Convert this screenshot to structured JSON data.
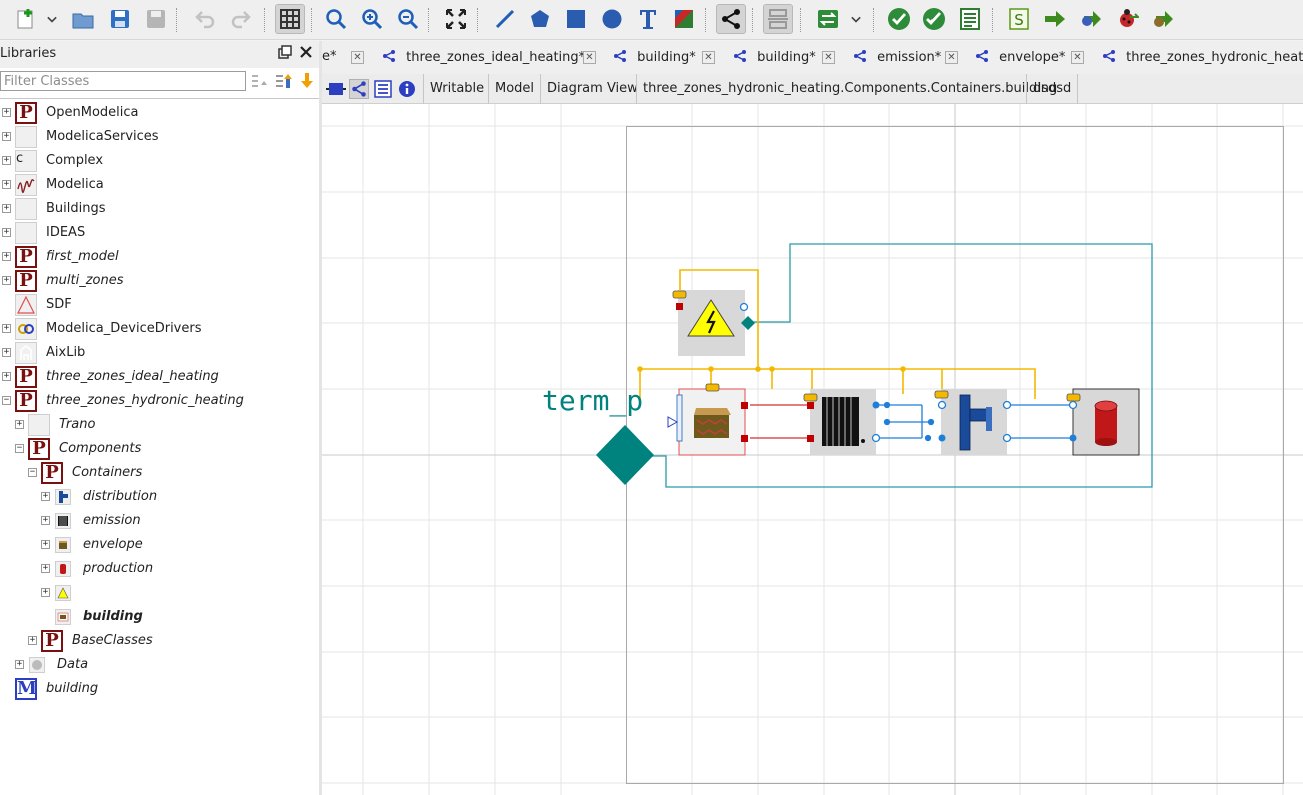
{
  "toolbar": {
    "buttons": [
      "new-icon",
      "dropdown-icon",
      "open-icon",
      "save-icon",
      "save-all-icon",
      "undo-icon",
      "redo-icon",
      "grid-icon",
      "zoom-reset-icon",
      "zoom-in-icon",
      "zoom-out-icon",
      "fit-icon",
      "line-icon",
      "polygon-icon",
      "rectangle-icon",
      "ellipse-icon",
      "text-icon",
      "bitmap-icon",
      "connect-icon",
      "transition-icon",
      "swap-icon",
      "dropdown-icon",
      "check-icon",
      "check-all-icon",
      "instantiate-icon",
      "simulation-setup-icon",
      "simulate-icon",
      "simulate-debug-icon",
      "debug-icon",
      "debug-algorithmic-icon"
    ]
  },
  "libraries": {
    "title": "Libraries",
    "filter_placeholder": "Filter Classes",
    "tree": [
      {
        "label": "OpenModelica",
        "icon": "package",
        "style": "normal"
      },
      {
        "label": "ModelicaServices",
        "icon": "blank",
        "style": "normal"
      },
      {
        "label": "Complex",
        "icon": "class-c",
        "style": "normal"
      },
      {
        "label": "Modelica",
        "icon": "modelica",
        "style": "normal"
      },
      {
        "label": "Buildings",
        "icon": "blank",
        "style": "normal"
      },
      {
        "label": "IDEAS",
        "icon": "blank",
        "style": "normal"
      },
      {
        "label": "first_model",
        "icon": "package",
        "style": "italic"
      },
      {
        "label": "multi_zones",
        "icon": "package",
        "style": "italic"
      },
      {
        "label": "SDF",
        "icon": "triangle",
        "style": "normal"
      },
      {
        "label": "Modelica_DeviceDrivers",
        "icon": "devicedrivers",
        "style": "normal"
      },
      {
        "label": "AixLib",
        "icon": "aixlib",
        "style": "normal"
      },
      {
        "label": "three_zones_ideal_heating",
        "icon": "package",
        "style": "italic"
      },
      {
        "label": "three_zones_hydronic_heating",
        "icon": "package",
        "style": "italic"
      },
      {
        "label": "Trano",
        "icon": "blank",
        "style": "italic"
      },
      {
        "label": "Components",
        "icon": "package",
        "style": "italic"
      },
      {
        "label": "Containers",
        "icon": "package",
        "style": "italic"
      },
      {
        "label": "distribution",
        "icon": "distribution",
        "style": "italic"
      },
      {
        "label": "emission",
        "icon": "emission",
        "style": "italic"
      },
      {
        "label": "envelope",
        "icon": "envelope",
        "style": "italic"
      },
      {
        "label": "production",
        "icon": "production",
        "style": "italic"
      },
      {
        "label": "",
        "icon": "electric",
        "style": "italic"
      },
      {
        "label": "building",
        "icon": "building-small",
        "style": "bold"
      },
      {
        "label": "BaseClasses",
        "icon": "package",
        "style": "italic"
      },
      {
        "label": "Data",
        "icon": "data",
        "style": "italic"
      },
      {
        "label": "building",
        "icon": "model",
        "style": "italic"
      }
    ]
  },
  "tabs": [
    {
      "label": "e*"
    },
    {
      "label": "three_zones_ideal_heating*"
    },
    {
      "label": "building*"
    },
    {
      "label": "building*"
    },
    {
      "label": "emission*"
    },
    {
      "label": "envelope*"
    },
    {
      "label": "three_zones_hydronic_heating"
    }
  ],
  "model_toolbar": {
    "access": "Writable",
    "restriction": "Model",
    "view": "Diagram View",
    "path": "three_zones_hydronic_heating.Components.Containers.building",
    "comment": "dsdsd"
  },
  "diagram": {
    "label": "term_p",
    "colors": {
      "teal": "#00827f",
      "yellow": "#f5b800",
      "red": "#c00000",
      "blue": "#1e6fd9"
    }
  }
}
